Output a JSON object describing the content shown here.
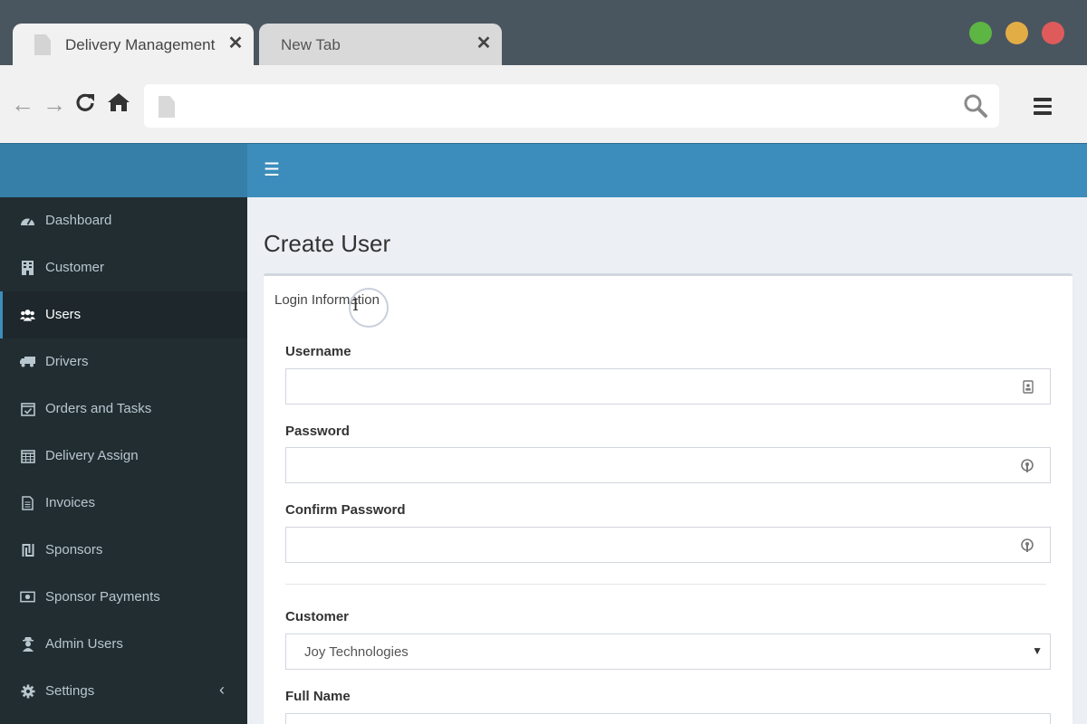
{
  "browser": {
    "tabs": [
      {
        "title": "Delivery Management",
        "active": true
      },
      {
        "title": "New Tab",
        "active": false
      }
    ],
    "address_value": "",
    "window_controls": [
      "green",
      "yellow",
      "red"
    ],
    "colors": {
      "chrome": "#4a565f",
      "minimize": "#5db544",
      "maximize": "#e3ad46",
      "close": "#df5b5b"
    }
  },
  "app": {
    "colors": {
      "header": "#3c8dbc",
      "sidebar": "#222d32",
      "sidebar_text": "#b8c7ce"
    },
    "sidebar": {
      "items": [
        {
          "label": "Dashboard",
          "icon": "dashboard-icon"
        },
        {
          "label": "Customer",
          "icon": "building-icon"
        },
        {
          "label": "Users",
          "icon": "users-icon",
          "active": true
        },
        {
          "label": "Drivers",
          "icon": "truck-icon"
        },
        {
          "label": "Orders and Tasks",
          "icon": "calendar-check-icon"
        },
        {
          "label": "Delivery Assign",
          "icon": "calendar-icon"
        },
        {
          "label": "Invoices",
          "icon": "file-text-icon"
        },
        {
          "label": "Sponsors",
          "icon": "shekel-icon"
        },
        {
          "label": "Sponsor Payments",
          "icon": "money-icon"
        },
        {
          "label": "Admin Users",
          "icon": "user-secret-icon"
        },
        {
          "label": "Settings",
          "icon": "gear-icon",
          "expandable": true
        }
      ]
    },
    "page_title": "Create User",
    "form": {
      "section_title": "Login Information",
      "username_label": "Username",
      "username_value": "",
      "password_label": "Password",
      "password_value": "",
      "confirm_password_label": "Confirm Password",
      "confirm_password_value": "",
      "customer_label": "Customer",
      "customer_value": "Joy Technologies",
      "full_name_label": "Full Name"
    }
  }
}
